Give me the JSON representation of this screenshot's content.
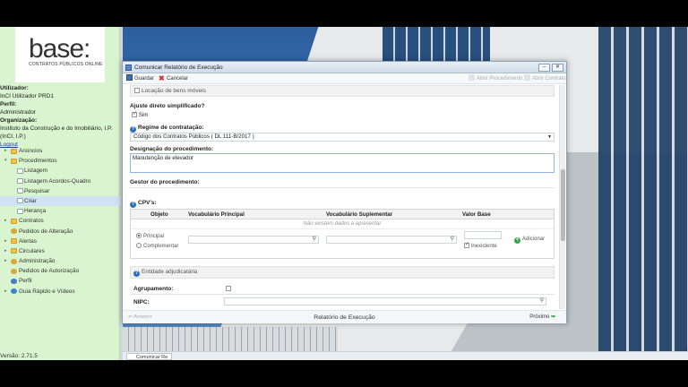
{
  "sidebar": {
    "logo": {
      "main": "base:",
      "sub": "CONTRATOS PÚBLICOS ONLINE"
    },
    "user": {
      "utilizador_label": "Utilizador:",
      "utilizador_value": "InCI Utilizador PRD1",
      "perfil_label": "Perfil:",
      "perfil_value": "Administrador",
      "organizacao_label": "Organização:",
      "organizacao_value": "Instituto da Construção e do Imobiliário, I.P. (InCI, I.P.)",
      "logout": "Logout"
    },
    "items": [
      {
        "label": "Anúncios"
      },
      {
        "label": "Procedimentos"
      },
      {
        "label": "Listagem"
      },
      {
        "label": "Listagem Acordos-Quadro"
      },
      {
        "label": "Pesquisar"
      },
      {
        "label": "Criar"
      },
      {
        "label": "Herança"
      },
      {
        "label": "Contratos"
      },
      {
        "label": "Pedidos de Alteração"
      },
      {
        "label": "Alertas"
      },
      {
        "label": "Circulares"
      },
      {
        "label": "Administração"
      },
      {
        "label": "Pedidos de Autorização"
      },
      {
        "label": "Perfil"
      },
      {
        "label": "Guia Rápido e Vídeos"
      }
    ],
    "version": "Versão: 2.71.5"
  },
  "taskbar": {
    "item": "Comunicar Re"
  },
  "modal": {
    "title": "Comunicar Relatório de Execução",
    "toolbar": {
      "save": "Guardar",
      "cancel": "Cancelar",
      "open_procedure": "Abrir Procedimento",
      "open_contract": "Abrir Contrato"
    },
    "form": {
      "locacao_label": "Locação de bens móveis",
      "ajuste_label": "Ajuste direto simplificado?",
      "sim_label": "Sim",
      "regime_label": "Regime de contratação:",
      "regime_value": "Código dos Contratos Públicos ( DL 111-B/2017 )",
      "designacao_label": "Designação do procedimento:",
      "designacao_value": "Manutenção de elevador",
      "gestor_label": "Gestor do procedimento:",
      "cpv_label": "CPV's:",
      "cpv_columns": [
        "Objeto",
        "Vocabulário Principal",
        "Vocabulário Suplementar",
        "Valor Base"
      ],
      "cpv_empty": "Não existem dados a apresentar",
      "principal_label": "Principal",
      "complementar_label": "Complementar",
      "inexistente_label": "Inexistente",
      "adicionar_label": "Adicionar",
      "entidade_label": "Entidade adjudicatária",
      "agrupamento_label": "Agrupamento:",
      "nipc_label": "NIPC:"
    },
    "footer": {
      "prev": "Anterior",
      "title": "Relatório de Execução",
      "next": "Próximo"
    }
  }
}
